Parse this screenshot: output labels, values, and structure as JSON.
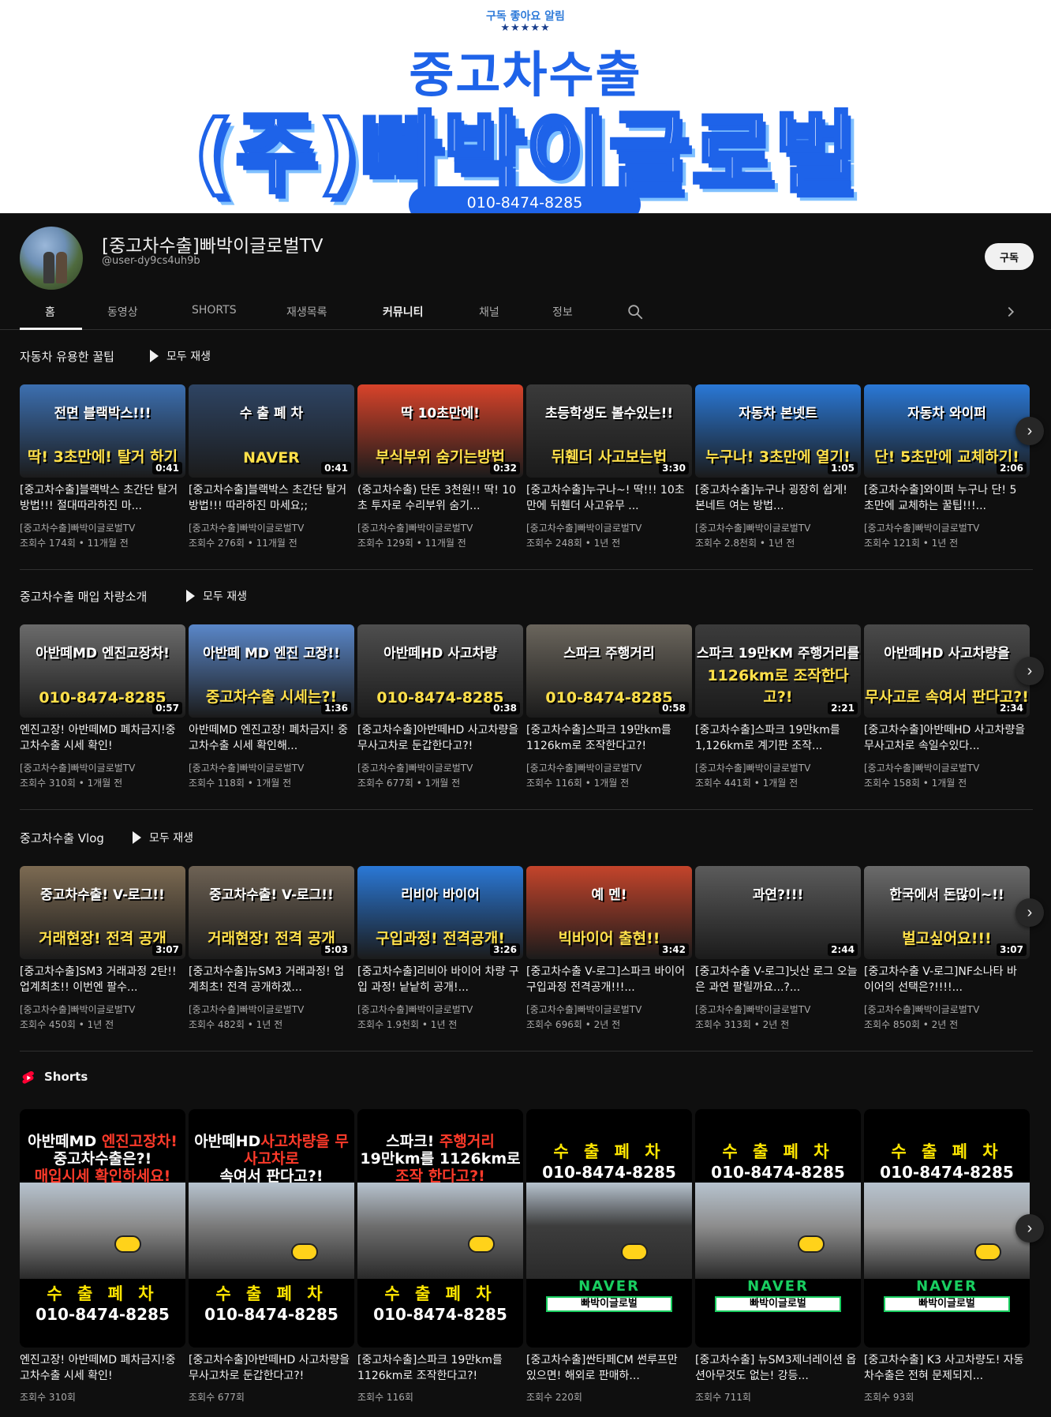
{
  "banner": {
    "tagline": "구독 좋아요 알림",
    "stars": "★★★★★",
    "line1": "중고차수출",
    "line2": "(주)빠박이글로벌",
    "phone": "010-8474-8285"
  },
  "channel": {
    "title": "[중고차수출]빠박이글로벌TV",
    "handle": "@user-dy9cs4uh9b",
    "subscribe_label": "구독"
  },
  "tabs": [
    {
      "label": "홈"
    },
    {
      "label": "동영상"
    },
    {
      "label": "SHORTS"
    },
    {
      "label": "재생목록"
    },
    {
      "label": "커뮤니티"
    },
    {
      "label": "채널"
    },
    {
      "label": "정보"
    }
  ],
  "sections": [
    {
      "title": "자동차 유용한 꿀팁",
      "play_all": "모두 재생",
      "videos": [
        {
          "cap1": "전면 블랙박스!!!",
          "cap2": "딱! 3초만에! 탈거 하기",
          "duration": "0:41",
          "title": "[중고차수출]블랙박스 초간단 탈거방법!!! 절대따라하진 마...",
          "channel": "[중고차수출]빠박이글로벌TV",
          "meta": "조회수 174회 • 11개월 전",
          "bg": "#3c6fb0"
        },
        {
          "cap1": "수 출 폐 차",
          "cap2": "NAVER",
          "duration": "0:41",
          "title": "[중고차수출]블랙박스 초간단 탈거 방법!!! 따라하진 마세요;;",
          "channel": "[중고차수출]빠박이글로벌TV",
          "meta": "조회수 276회 • 11개월 전",
          "bg": "#2e4463"
        },
        {
          "cap1": "딱 10초만에!",
          "cap2": "부식부위 숨기는방법",
          "duration": "0:32",
          "title": "(중고차수출) 단돈 3천원!! 딱! 10초 투자로 수리부위 숨기...",
          "channel": "[중고차수출]빠박이글로벌TV",
          "meta": "조회수 129회 • 11개월 전",
          "bg": "#d8432a"
        },
        {
          "cap1": "초등학생도 볼수있는!!",
          "cap2": "뒤휀더 사고보는법",
          "duration": "3:30",
          "title": "[중고차수출]누구나~! 딱!!! 10초만에 뒤휀더 사고유무 ...",
          "channel": "[중고차수출]빠박이글로벌TV",
          "meta": "조회수 248회 • 1년 전",
          "bg": "#3a3a3a"
        },
        {
          "cap1": "자동차 본넷트",
          "cap2": "누구나! 3초만에 열기!",
          "duration": "1:05",
          "title": "[중고차수출]누구나 굉장히 쉽게! 본네트 여는 방법...",
          "channel": "[중고차수출]빠박이글로벌TV",
          "meta": "조회수 2.8천회 • 1년 전",
          "bg": "#2a78d6"
        },
        {
          "cap1": "자동차 와이퍼",
          "cap2": "단! 5초만에 교체하기!",
          "duration": "2:06",
          "title": "[중고차수출]와이퍼 누구나 단! 5초만에 교체하는 꿀팁!!!...",
          "channel": "[중고차수출]빠박이글로벌TV",
          "meta": "조회수 121회 • 1년 전",
          "bg": "#2a78d6"
        }
      ]
    },
    {
      "title": "중고차수출 매입 차량소개",
      "play_all": "모두 재생",
      "videos": [
        {
          "cap1": "아반떼MD 엔진고장차!",
          "cap2": "010-8474-8285",
          "duration": "0:57",
          "title": "엔진고장! 아반떼MD 폐차금지!중고차수출 시세 확인!",
          "channel": "[중고차수출]빠박이글로벌TV",
          "meta": "조회수 310회 • 1개월 전",
          "bg": "#6b6b6b"
        },
        {
          "cap1": "아반떼 MD 엔진 고장!!",
          "cap2": "중고차수출 시세는?!",
          "duration": "1:36",
          "title": "아반떼MD 엔진고장! 폐차금지! 중고차수출 시세 확인해...",
          "channel": "[중고차수출]빠박이글로벌TV",
          "meta": "조회수 118회 • 1개월 전",
          "bg": "#5a87c9"
        },
        {
          "cap1": "아반떼HD 사고차량",
          "cap2": "010-8474-8285",
          "duration": "0:38",
          "title": "[중고차수출]아반떼HD 사고차량을 무사고차로 둔갑한다고?!",
          "channel": "[중고차수출]빠박이글로벌TV",
          "meta": "조회수 677회 • 1개월 전",
          "bg": "#4e4e4e"
        },
        {
          "cap1": "스파크 주행거리",
          "cap2": "010-8474-8285",
          "duration": "0:58",
          "title": "[중고차수출]스파크 19만km를 1126km로 조작한다고?!",
          "channel": "[중고차수출]빠박이글로벌TV",
          "meta": "조회수 116회 • 1개월 전",
          "bg": "#6a655c"
        },
        {
          "cap1": "스파크 19만KM 주행거리를",
          "cap2": "1126km로 조작한다고?!",
          "duration": "2:21",
          "title": "[중고차수출]스파크 19만km를 1,126km로 계기판 조작...",
          "channel": "[중고차수출]빠박이글로벌TV",
          "meta": "조회수 441회 • 1개월 전",
          "bg": "#3b3b3b"
        },
        {
          "cap1": "아반떼HD 사고차량을",
          "cap2": "무사고로 속여서 판다고?!",
          "duration": "2:34",
          "title": "[중고차수출]아반떼HD 사고차량을 무사고차로 속일수있다...",
          "channel": "[중고차수출]빠박이글로벌TV",
          "meta": "조회수 158회 • 1개월 전",
          "bg": "#4a4a4a"
        }
      ]
    },
    {
      "title": "중고차수출 Vlog",
      "play_all": "모두 재생",
      "videos": [
        {
          "cap1": "중고차수출! V-로그!!",
          "cap2": "거래현장! 전격 공개",
          "duration": "3:07",
          "title": "[중고차수출]SM3 거래과정 2탄!! 업계최초!! 이번엔 팔수...",
          "channel": "[중고차수출]빠박이글로벌TV",
          "meta": "조회수 450회 • 1년 전",
          "bg": "#7c6a52"
        },
        {
          "cap1": "중고차수출! V-로그!!",
          "cap2": "거래현장! 전격 공개",
          "duration": "5:03",
          "title": "[중고차수출]뉴SM3 거래과정! 업계최초! 전격 공개하겠...",
          "channel": "[중고차수출]빠박이글로벌TV",
          "meta": "조회수 482회 • 1년 전",
          "bg": "#6e6254"
        },
        {
          "cap1": "리비아 바이어",
          "cap2": "구입과정! 전격공개!",
          "duration": "3:26",
          "title": "[중고차수출]리비아 바이어 차량 구입 과정! 낱낱히 공개!...",
          "channel": "[중고차수출]빠박이글로벌TV",
          "meta": "조회수 1.9천회 • 1년 전",
          "bg": "#2a78d6"
        },
        {
          "cap1": "예 멘!",
          "cap2": "빅바이어 출현!!",
          "duration": "3:42",
          "title": "[중고차수출 V-로그]스파크 바이어 구입과정 전격공개!!!...",
          "channel": "[중고차수출]빠박이글로벌TV",
          "meta": "조회수 696회 • 2년 전",
          "bg": "#c4442b"
        },
        {
          "cap1": "과연?!!!",
          "cap2": "",
          "duration": "2:44",
          "title": "[중고차수출 V-로그]닛산 로그 오늘은 과연 팔릴까요...?...",
          "channel": "[중고차수출]빠박이글로벌TV",
          "meta": "조회수 313회 • 2년 전",
          "bg": "#5b5b5b"
        },
        {
          "cap1": "한국에서 돈많이~!!",
          "cap2": "벌고싶어요!!!",
          "duration": "3:07",
          "title": "[중고차수출 V-로그]NF소나타 바이어의 선택은?!!!!...",
          "channel": "[중고차수출]빠박이글로벌TV",
          "meta": "조회수 850회 • 2년 전",
          "bg": "#6b6b6b"
        }
      ]
    }
  ],
  "shorts": {
    "title": "Shorts",
    "items": [
      {
        "top": [
          "아반떼MD ",
          "엔진고장차!",
          "중고차수출은?!",
          "매입시세 확인하세요!"
        ],
        "bottom1": "수 출 폐 차",
        "bottom2": "010-8474-8285",
        "title": "엔진고장! 아반떼MD 폐차금지!중고차수출 시세 확인!",
        "views": "조회수 310회",
        "photo": "#8a8a8a"
      },
      {
        "top": [
          "아반떼HD",
          "사고차량을 무사고차로",
          "속여서 판다고?!",
          ""
        ],
        "bottom1": "수 출 폐 차",
        "bottom2": "010-8474-8285",
        "title": "[중고차수출]아반떼HD 사고차량을 무사고차로 둔갑한다고?!",
        "views": "조회수 677회",
        "photo": "#7a7a7a"
      },
      {
        "top": [
          "스파크! ",
          "주행거리",
          "19만km를 1126km로",
          "조작 한다고?!"
        ],
        "bottom1": "수 출 폐 차",
        "bottom2": "010-8474-8285",
        "title": "[중고차수출]스파크 19만km를 1126km로 조작한다고?!",
        "views": "조회수 116회",
        "photo": "#6e6e6e"
      },
      {
        "top_phone1": "수 출 폐 차",
        "top_phone2": "010-8474-8285",
        "naver1": "NAVER",
        "naver2": "빠박이글로벌",
        "title": "[중고차수출]싼타페CM 썬루프만 있으면! 해외로 판매하...",
        "views": "조회수 220회",
        "photo": "#3d3d3d"
      },
      {
        "top_phone1": "수 출 폐 차",
        "top_phone2": "010-8474-8285",
        "naver1": "NAVER",
        "naver2": "빠박이글로벌",
        "title": "[중고차수출] 뉴SM3제너레이션 옵션아무것도 없는! 강등...",
        "views": "조회수 711회",
        "photo": "#8d8d8d"
      },
      {
        "top_phone1": "수 출 폐 차",
        "top_phone2": "010-8474-8285",
        "naver1": "NAVER",
        "naver2": "빠박이글로벌",
        "title": "[중고차수출] K3 사고차량도! 자동차수출은 전혀 문제되지...",
        "views": "조회수 93회",
        "photo": "#9c9c9c"
      }
    ]
  },
  "colors": {
    "background": "#0f0f0f",
    "text_primary": "#f1f1f1",
    "text_secondary": "#aaaaaa",
    "shorts_red": "#ff0033",
    "banner_blue": "#1e63e9"
  }
}
